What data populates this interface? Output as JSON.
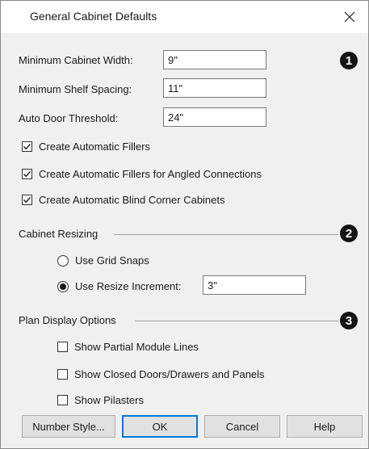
{
  "dialog": {
    "title": "General Cabinet Defaults"
  },
  "fields": [
    {
      "label": "Minimum Cabinet Width:",
      "value": "9\""
    },
    {
      "label": "Minimum Shelf Spacing:",
      "value": "11\""
    },
    {
      "label": "Auto Door Threshold:",
      "value": "24\""
    }
  ],
  "checkboxes": [
    {
      "label": "Create Automatic Fillers",
      "checked": true
    },
    {
      "label": "Create Automatic Fillers for Angled Connections",
      "checked": true
    },
    {
      "label": "Create Automatic Blind Corner Cabinets",
      "checked": true
    }
  ],
  "resizing": {
    "heading": "Cabinet Resizing",
    "options": [
      {
        "label": "Use Grid Snaps",
        "selected": false
      },
      {
        "label": "Use Resize Increment:",
        "selected": true
      }
    ],
    "increment_value": "3\""
  },
  "plan_display": {
    "heading": "Plan Display Options",
    "options": [
      {
        "label": "Show Partial Module Lines",
        "checked": false
      },
      {
        "label": "Show Closed Doors/Drawers and Panels",
        "checked": false
      },
      {
        "label": "Show Pilasters",
        "checked": false
      }
    ]
  },
  "callouts": [
    "1",
    "2",
    "3"
  ],
  "buttons": {
    "number_style": "Number Style...",
    "ok": "OK",
    "cancel": "Cancel",
    "help": "Help"
  },
  "colors": {
    "default_button_border": "#0078d7",
    "callout_fill": "#141414"
  },
  "icons": {
    "close": "close-icon",
    "check": "checkmark-icon"
  }
}
